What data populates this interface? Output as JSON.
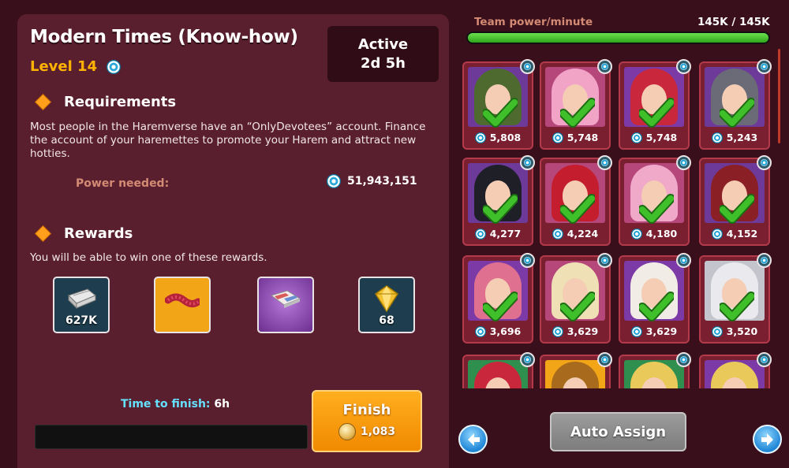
{
  "mission": {
    "title": "Modern Times (Know-how)",
    "level": "Level 14",
    "status_line1": "Active",
    "status_line2": "2d 5h"
  },
  "requirements": {
    "heading": "Requirements",
    "description": "Most people in the Haremverse have an “OnlyDevotees” account. Finance the account of your haremettes to promote your Harem and attract new hotties.",
    "power_label": "Power needed:",
    "power_value": "51,943,151"
  },
  "rewards": {
    "heading": "Rewards",
    "text": "You will be able to win one of these rewards.",
    "items": [
      {
        "icon": "cash-stack-icon",
        "value": "627K",
        "bg": "#1e3e4f"
      },
      {
        "icon": "feather-boa-icon",
        "value": "",
        "bg": "#f2a516"
      },
      {
        "icon": "magazine-icon",
        "value": "",
        "bg": "#8a43b3"
      },
      {
        "icon": "gem-icon",
        "value": "68",
        "bg": "#1e3e4f"
      }
    ]
  },
  "timer": {
    "label": "Time to finish:",
    "value": "6h",
    "progress": 0
  },
  "finish_button": {
    "label": "Finish",
    "cost": "1,083"
  },
  "team": {
    "label": "Team power/minute",
    "value": "145K / 145K",
    "fill_fraction": 1.0
  },
  "girls": [
    {
      "power": "5,808",
      "hair": "#4f6a2e",
      "bg": "#6e3a9a"
    },
    {
      "power": "5,748",
      "hair": "#f2a4c6",
      "bg": "#b5477b"
    },
    {
      "power": "5,748",
      "hair": "#c9283c",
      "bg": "#7b3aa6"
    },
    {
      "power": "5,243",
      "hair": "#6b6b78",
      "bg": "#6e3a9a"
    },
    {
      "power": "4,277",
      "hair": "#1f1f28",
      "bg": "#6e3a9a"
    },
    {
      "power": "4,224",
      "hair": "#c41e2e",
      "bg": "#b5477b"
    },
    {
      "power": "4,180",
      "hair": "#f0a9c9",
      "bg": "#b5477b"
    },
    {
      "power": "4,152",
      "hair": "#8a1f26",
      "bg": "#6e3a9a"
    },
    {
      "power": "3,696",
      "hair": "#e0708f",
      "bg": "#7b3aa6"
    },
    {
      "power": "3,629",
      "hair": "#efe0b5",
      "bg": "#b5477b"
    },
    {
      "power": "3,629",
      "hair": "#f1ece6",
      "bg": "#7b3aa6"
    },
    {
      "power": "3,520",
      "hair": "#e9e9ee",
      "bg": "#c4c4cc"
    },
    {
      "power": "",
      "hair": "#c9283c",
      "bg": "#2f8f4e"
    },
    {
      "power": "",
      "hair": "#a86a1c",
      "bg": "#f2a516"
    },
    {
      "power": "",
      "hair": "#e8c95a",
      "bg": "#2f8f4e"
    },
    {
      "power": "",
      "hair": "#e8c95a",
      "bg": "#7b3aa6"
    }
  ],
  "buttons": {
    "auto_assign": "Auto Assign",
    "prev": "left-arrow-icon",
    "next": "right-arrow-icon"
  },
  "colors": {
    "accent_orange": "#ffb300",
    "time_label": "#66e0ff",
    "power_label": "#d48b74",
    "checkmark": "#3fc02a"
  }
}
